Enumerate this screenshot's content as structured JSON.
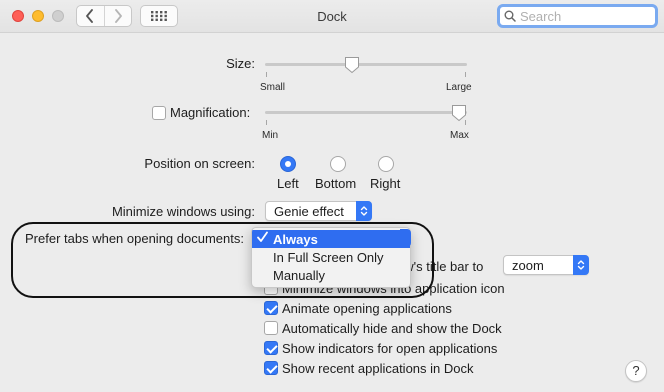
{
  "window": {
    "title": "Dock"
  },
  "toolbar": {
    "search_placeholder": "Search",
    "icons": [
      "back-icon",
      "forward-icon",
      "grid-icon"
    ]
  },
  "size": {
    "label": "Size:",
    "min_label": "Small",
    "max_label": "Large",
    "value_fraction": 0.43
  },
  "magnification": {
    "label": "Magnification:",
    "checked": false,
    "min_label": "Min",
    "max_label": "Max",
    "value_fraction": 1.0
  },
  "position": {
    "label": "Position on screen:",
    "options": [
      "Left",
      "Bottom",
      "Right"
    ],
    "selected": "Left"
  },
  "minimize": {
    "label": "Minimize windows using:",
    "value": "Genie effect"
  },
  "prefer_tabs": {
    "label": "Prefer tabs when opening documents:",
    "menu_items": [
      "Always",
      "In Full Screen Only",
      "Manually"
    ],
    "selected": "Always"
  },
  "double_click": {
    "label_fragment": "ow's title bar to",
    "value": "zoom"
  },
  "checkboxes": [
    {
      "label": "Minimize windows into application icon",
      "checked": false
    },
    {
      "label": "Animate opening applications",
      "checked": true
    },
    {
      "label": "Automatically hide and show the Dock",
      "checked": false
    },
    {
      "label": "Show indicators for open applications",
      "checked": true
    },
    {
      "label": "Show recent applications in Dock",
      "checked": true
    }
  ],
  "help": {
    "label": "?"
  },
  "colors": {
    "accent": "#3478f6",
    "menu_highlight": "#2f6df0",
    "close": "#fe5f57",
    "minimize": "#febc2e"
  }
}
